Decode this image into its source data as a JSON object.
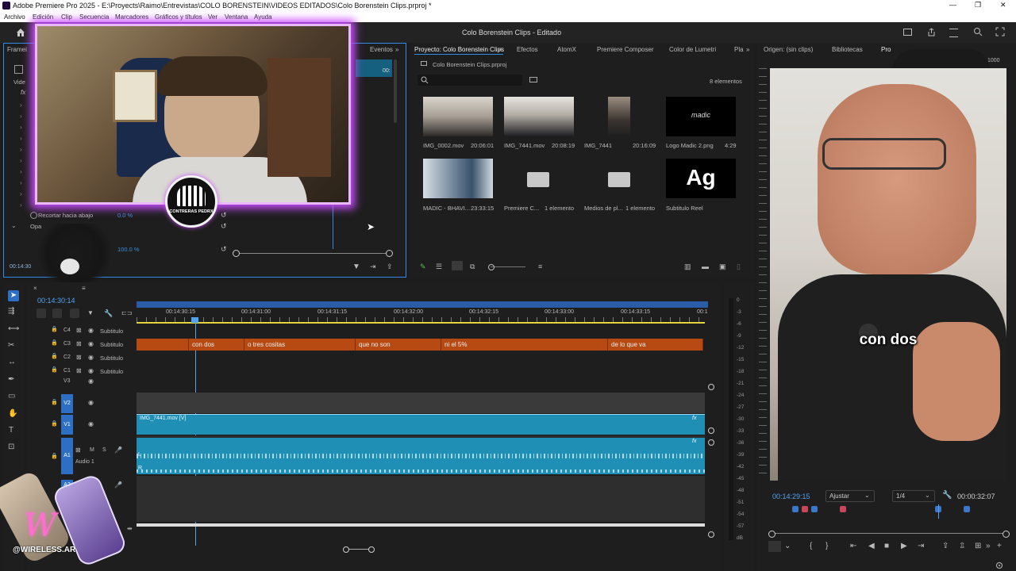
{
  "window": {
    "title": "Adobe Premiere Pro 2025 - E:\\Proyects\\Raimo\\Entrevistas\\COLO BORENSTEIN\\VIDEOS EDITADOS\\Colo Borenstein Clips.prproj *",
    "controls": [
      "—",
      "❐",
      "✕"
    ]
  },
  "menu": [
    "Archivo",
    "Edición",
    "Clip",
    "Secuencia",
    "Marcadores",
    "Gráficos y títulos",
    "Ver",
    "Ventana",
    "Ayuda"
  ],
  "header": {
    "project_title": "Colo Borenstein Clips",
    "status": "Editado"
  },
  "effect_controls": {
    "tab_label": "Framei",
    "events_tab": "Eventos",
    "recortar_label": "Recortar hacia abajo",
    "recortar_value": "0.0 %",
    "opacity_label": "Opa",
    "opacity_value": "100.0 %",
    "timecode": "00:14:30",
    "video_label": "Vide",
    "fx": "fx",
    "marker_time": "00:"
  },
  "project_panel": {
    "tabs": [
      "Proyecto: Colo Borenstein Clips",
      "Efectos",
      "AtomX",
      "Premiere Composer",
      "Color de Lumetri",
      "Pla"
    ],
    "file": "Colo Borenstein Clips.prproj",
    "count": "8 elementos",
    "items": [
      {
        "name": "IMG_0002.mov",
        "meta": "20:06:01",
        "kind": "video"
      },
      {
        "name": "IMG_7441.mov",
        "meta": "20:08:19",
        "kind": "video"
      },
      {
        "name": "IMG_7441",
        "meta": "20:16:09",
        "kind": "video"
      },
      {
        "name": "Logo Madic 2.png",
        "meta": "4:29",
        "kind": "logo",
        "logo_text": "madic"
      },
      {
        "name": "MADIC - BHAVI...",
        "meta": "23:33:15",
        "kind": "video"
      },
      {
        "name": "Premiere C...",
        "meta": "1 elemento",
        "kind": "folder"
      },
      {
        "name": "Medios de pl...",
        "meta": "1 elemento",
        "kind": "folder"
      },
      {
        "name": "Subtitulo Reel",
        "meta": "",
        "kind": "text",
        "glyph": "Ag"
      }
    ]
  },
  "source_monitor": {
    "tabs": [
      "Origen: (sin clips)",
      "Bibliotecas",
      "Pro"
    ],
    "ruler_end": "1000",
    "caption": "con dos",
    "timecode_left": "00:14:29:15",
    "fit": "Ajustar",
    "quality": "1/4",
    "timecode_right": "00:00:32:07"
  },
  "timeline": {
    "timecode": "00:14:30:14",
    "ruler": [
      "00:14:30:15",
      "00:14:31:00",
      "00:14:31:15",
      "00:14:32:00",
      "00:14:32:15",
      "00:14:33:00",
      "00:14:33:15",
      "00:1"
    ],
    "tracks": [
      {
        "id": "C4",
        "name": "Subtitulo"
      },
      {
        "id": "C3",
        "name": "Subtitulo"
      },
      {
        "id": "C2",
        "name": "Subtitulo"
      },
      {
        "id": "C1",
        "name": "Subtitulo"
      }
    ],
    "video_tracks": [
      "V3",
      "V2",
      "V1"
    ],
    "audio": {
      "id": "A1",
      "name": "Audio 1",
      "m": "M",
      "s": "S"
    },
    "audio2": {
      "id": "A2",
      "m": "M"
    },
    "captions": [
      "con dos",
      "o tres cositas",
      "que no son",
      "ni el 5%",
      "de lo que va"
    ],
    "video_clip": "IMG_7441.mov [V]",
    "fx": "fx",
    "lr": [
      "L",
      "R"
    ]
  },
  "meter": {
    "labels": [
      "0",
      "-3",
      "-6",
      "-9",
      "-12",
      "-15",
      "-18",
      "-21",
      "-24",
      "-27",
      "-30",
      "-33",
      "-36",
      "-39",
      "-42",
      "-45",
      "-48",
      "-51",
      "-54",
      "-57",
      "dB"
    ]
  },
  "overlays": {
    "badge_text": "CONTRERAS PEDRX",
    "watermark": "@WIRELESS.AR",
    "w_glyph": "W"
  },
  "colors": {
    "accent_blue": "#2d8ceb",
    "caption_orange": "#b74a12",
    "clip_teal": "#1f8fb5",
    "webcam_glow": "#c84dff"
  }
}
